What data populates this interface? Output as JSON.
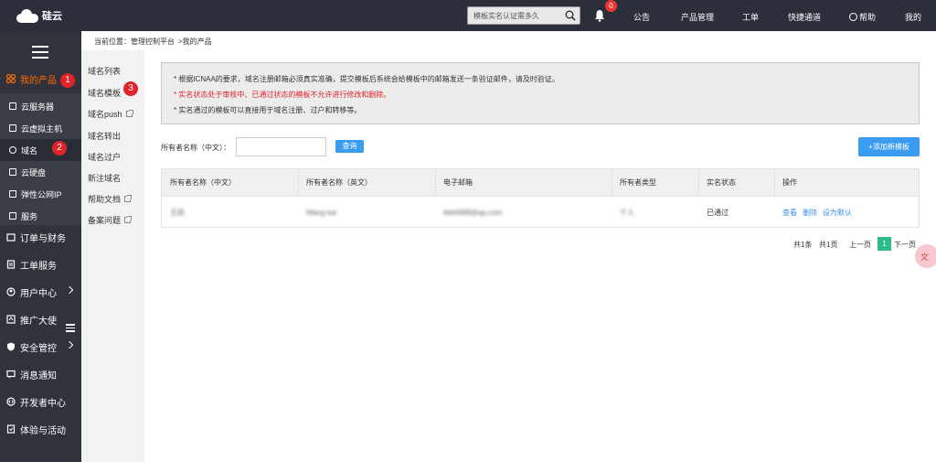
{
  "app": {
    "logo_text": "硅云"
  },
  "topbar": {
    "search": {
      "value": "模板实名认证需多久",
      "icon": "search-icon"
    },
    "notifications": {
      "count": "0",
      "icon": "bell-icon"
    },
    "nav": [
      {
        "label": "公告"
      },
      {
        "label": "产品管理"
      },
      {
        "label": "工单"
      },
      {
        "label": "快捷通道"
      },
      {
        "label": "帮助",
        "icon": "headset-icon"
      },
      {
        "label": "我的"
      }
    ]
  },
  "sidebar": {
    "groups": [
      {
        "label": "我的产品",
        "icon": "grid-icon",
        "color": "#ff6a00"
      },
      {
        "label": "订单与财务",
        "icon": "wallet-icon"
      },
      {
        "label": "工单服务",
        "icon": "ticket-icon"
      },
      {
        "label": "用户中心",
        "icon": "user-icon"
      },
      {
        "label": "推广大使",
        "icon": "share-icon"
      },
      {
        "label": "安全管控",
        "icon": "shield-icon"
      },
      {
        "label": "消息通知",
        "icon": "message-icon"
      },
      {
        "label": "开发者中心",
        "icon": "code-icon"
      },
      {
        "label": "体验与活动",
        "icon": "gift-icon"
      }
    ],
    "sub_items": [
      {
        "label": "云服务器"
      },
      {
        "label": "云虚拟主机"
      },
      {
        "label": "域名"
      },
      {
        "label": "云硬盘"
      },
      {
        "label": "弹性公网IP"
      },
      {
        "label": "服务"
      }
    ],
    "markers": [
      "1",
      "2",
      "3"
    ]
  },
  "domain_menu": [
    {
      "label": "域名列表"
    },
    {
      "label": "域名模板"
    },
    {
      "label": "域名push"
    },
    {
      "label": "域名转出"
    },
    {
      "label": "域名过户"
    },
    {
      "label": "新注域名"
    },
    {
      "label": "帮助文档"
    },
    {
      "label": "备案问题"
    }
  ],
  "breadcrumb": {
    "prefix": "当前位置：",
    "root": "管理控制平台",
    "sep": ">",
    "current": "我的产品"
  },
  "notice": [
    "*  根据ICNAA的要求，域名注册邮箱必须真实准确，提交模板后系统会给模板中的邮箱发送一条验证邮件，请及时验证。",
    "*  实名状态处于审核中、已通过状态的模板不允许进行修改和删除。",
    "*  实名通过的模板可以直接用于域名注册、过户和转移等。"
  ],
  "filter": {
    "label": "所有者名称（中文）：",
    "value": "",
    "query_label": "查询",
    "add_label": "+添加新模板"
  },
  "table": {
    "headers": [
      "所有者名称（中文）",
      "所有者名称（英文）",
      "电子邮箱",
      "所有者类型",
      "实名状态",
      "操作"
    ],
    "rows": [
      {
        "name_cn": "王凯",
        "name_en": "Wang kai",
        "email": "kkk6688@qq.com",
        "type": "个人",
        "status": "已通过",
        "actions": [
          "查看",
          "删除",
          "设为默认"
        ]
      }
    ]
  },
  "pagination": {
    "total": "共1条",
    "pages": "共1页",
    "prev": "上一页",
    "current": "1",
    "next": "下一页"
  },
  "floating": {
    "label": "文"
  }
}
